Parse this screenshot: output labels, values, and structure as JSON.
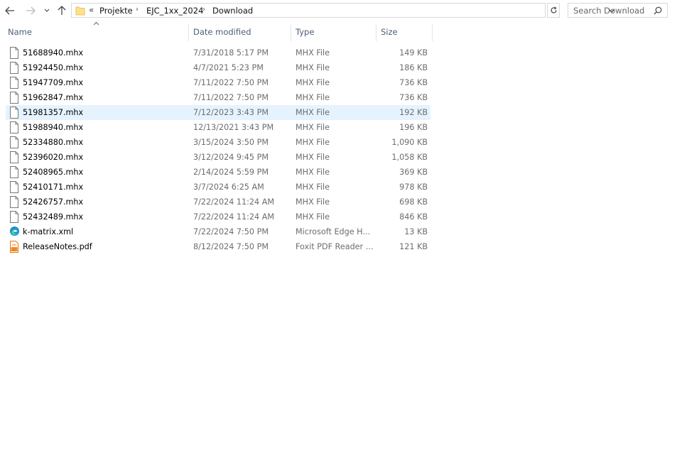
{
  "address": {
    "overflow": "«",
    "crumbs": [
      "Projekte",
      "EJC_1xx_2024",
      "Download"
    ]
  },
  "search": {
    "placeholder": "Search Download"
  },
  "columns": {
    "name": "Name",
    "date": "Date modified",
    "type": "Type",
    "size": "Size"
  },
  "files": [
    {
      "name": "51688940.mhx",
      "date": "7/31/2018 5:17 PM",
      "type": "MHX File",
      "size": "149 KB",
      "icon": "file-icon"
    },
    {
      "name": "51924450.mhx",
      "date": "4/7/2021 5:23 PM",
      "type": "MHX File",
      "size": "186 KB",
      "icon": "file-icon"
    },
    {
      "name": "51947709.mhx",
      "date": "7/11/2022 7:50 PM",
      "type": "MHX File",
      "size": "736 KB",
      "icon": "file-icon"
    },
    {
      "name": "51962847.mhx",
      "date": "7/11/2022 7:50 PM",
      "type": "MHX File",
      "size": "736 KB",
      "icon": "file-icon"
    },
    {
      "name": "51981357.mhx",
      "date": "7/12/2023 3:43 PM",
      "type": "MHX File",
      "size": "192 KB",
      "icon": "file-icon",
      "selected": true
    },
    {
      "name": "51988940.mhx",
      "date": "12/13/2021 3:43 PM",
      "type": "MHX File",
      "size": "196 KB",
      "icon": "file-icon"
    },
    {
      "name": "52334880.mhx",
      "date": "3/15/2024 3:50 PM",
      "type": "MHX File",
      "size": "1,090 KB",
      "icon": "file-icon"
    },
    {
      "name": "52396020.mhx",
      "date": "3/12/2024 9:45 PM",
      "type": "MHX File",
      "size": "1,058 KB",
      "icon": "file-icon"
    },
    {
      "name": "52408965.mhx",
      "date": "2/14/2024 5:59 PM",
      "type": "MHX File",
      "size": "369 KB",
      "icon": "file-icon"
    },
    {
      "name": "52410171.mhx",
      "date": "3/7/2024 6:25 AM",
      "type": "MHX File",
      "size": "978 KB",
      "icon": "file-icon"
    },
    {
      "name": "52426757.mhx",
      "date": "7/22/2024 11:24 AM",
      "type": "MHX File",
      "size": "698 KB",
      "icon": "file-icon"
    },
    {
      "name": "52432489.mhx",
      "date": "7/22/2024 11:24 AM",
      "type": "MHX File",
      "size": "846 KB",
      "icon": "file-icon"
    },
    {
      "name": "k-matrix.xml",
      "date": "7/22/2024 7:50 PM",
      "type": "Microsoft Edge H...",
      "size": "13 KB",
      "icon": "edge-icon"
    },
    {
      "name": "ReleaseNotes.pdf",
      "date": "8/12/2024 7:50 PM",
      "type": "Foxit PDF Reader ...",
      "size": "121 KB",
      "icon": "pdf-icon"
    }
  ]
}
